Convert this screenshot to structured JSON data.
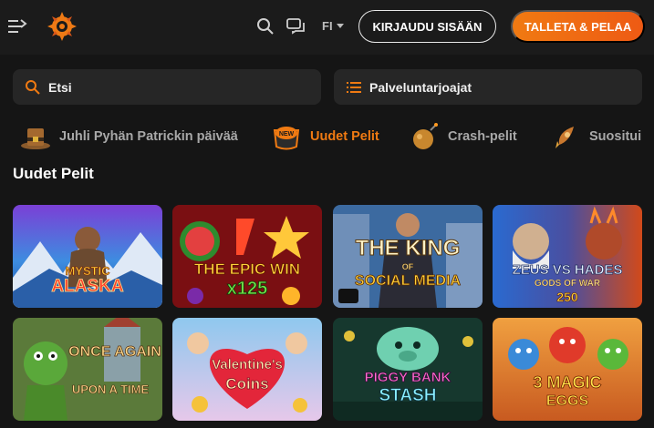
{
  "header": {
    "language": "FI",
    "login_label": "KIRJAUDU SISÄÄN",
    "deposit_label": "TALLETA & PELAA",
    "menu_icon": "menu-collapse-icon",
    "search_icon": "search-icon",
    "chat_icon": "chat-icon",
    "accent_color": "#f07a12"
  },
  "filters": {
    "search_placeholder": "Etsi",
    "providers_label": "Palveluntarjoajat"
  },
  "categories": [
    {
      "label": "Juhli Pyhän Patrickin päivää",
      "icon": "leprechaun-hat-icon",
      "active": false
    },
    {
      "label": "Uudet Pelit",
      "icon": "new-badge-icon",
      "badge": "NEW",
      "active": true
    },
    {
      "label": "Crash-pelit",
      "icon": "crash-bomb-icon",
      "active": false
    },
    {
      "label": "Suositui",
      "icon": "rocket-icon",
      "active": false
    }
  ],
  "section": {
    "title": "Uudet Pelit"
  },
  "games": [
    {
      "title_line1": "MYSTIC",
      "title_line2": "ALASKA",
      "title_line3": ""
    },
    {
      "title_line1": "THE EPIC WIN",
      "title_line2": "x125",
      "title_line3": ""
    },
    {
      "title_line1": "THE KING",
      "title_line2": "OF",
      "title_line3": "SOCIAL MEDIA"
    },
    {
      "title_line1": "ZEUS vs HADES",
      "title_line2": "GODS OF WAR",
      "title_line3": "250"
    },
    {
      "title_line1": "ONCE AGAIN",
      "title_line2": "UPON A TIME",
      "title_line3": ""
    },
    {
      "title_line1": "Valentine's",
      "title_line2": "Coins",
      "title_line3": ""
    },
    {
      "title_line1": "PIGGY BANK",
      "title_line2": "STASH",
      "title_line3": ""
    },
    {
      "title_line1": "3 MAGIC",
      "title_line2": "EGGS",
      "title_line3": ""
    }
  ]
}
